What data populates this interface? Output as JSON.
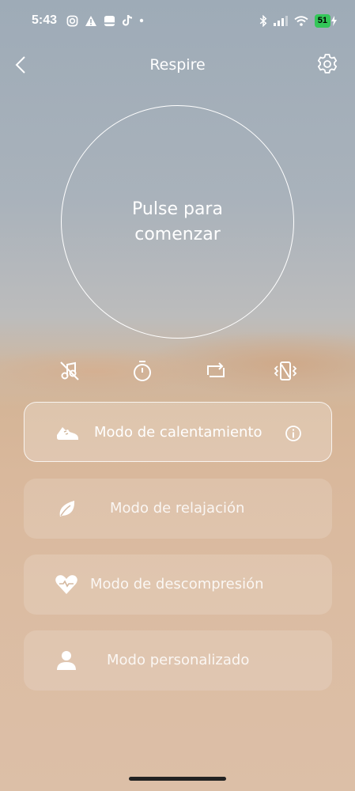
{
  "status_bar": {
    "time": "5:43",
    "battery": "51"
  },
  "nav": {
    "title": "Respire"
  },
  "start": {
    "label": "Pulse para comenzar"
  },
  "controls": {
    "items": [
      "no-music-icon",
      "timer-icon",
      "repeat-icon",
      "vibration-icon"
    ]
  },
  "modes": [
    {
      "label": "Modo de calentamiento",
      "icon": "sneaker-icon",
      "selected": true
    },
    {
      "label": "Modo de relajación",
      "icon": "leaf-icon",
      "selected": false
    },
    {
      "label": "Modo de descompresión",
      "icon": "heart-icon",
      "selected": false
    },
    {
      "label": "Modo personalizado",
      "icon": "person-icon",
      "selected": false
    }
  ],
  "colors": {
    "sky": "#9eabb7",
    "sand": "#d9b89c",
    "battery_fill": "#34c759"
  }
}
